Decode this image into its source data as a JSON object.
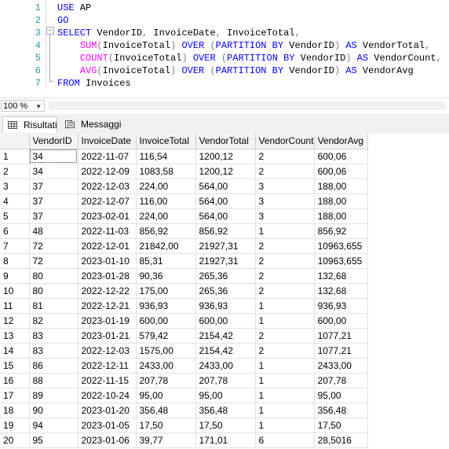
{
  "editor": {
    "lines": [
      {
        "n": "1",
        "tokens": [
          [
            "kw",
            "USE"
          ],
          [
            "tx",
            " AP"
          ]
        ]
      },
      {
        "n": "2",
        "tokens": [
          [
            "kw",
            "GO"
          ]
        ]
      },
      {
        "n": "3",
        "tokens": [
          [
            "kw",
            "SELECT"
          ],
          [
            "tx",
            " VendorID"
          ],
          [
            "op",
            ","
          ],
          [
            "tx",
            " InvoiceDate"
          ],
          [
            "op",
            ","
          ],
          [
            "tx",
            " InvoiceTotal"
          ],
          [
            "op",
            ","
          ]
        ]
      },
      {
        "n": "4",
        "tokens": [
          [
            "tx",
            "    "
          ],
          [
            "fn",
            "SUM"
          ],
          [
            "op",
            "("
          ],
          [
            "tx",
            "InvoiceTotal"
          ],
          [
            "op",
            ")"
          ],
          [
            "tx",
            " "
          ],
          [
            "kw",
            "OVER"
          ],
          [
            "tx",
            " "
          ],
          [
            "op",
            "("
          ],
          [
            "kw",
            "PARTITION BY"
          ],
          [
            "tx",
            " VendorID"
          ],
          [
            "op",
            ")"
          ],
          [
            "tx",
            " "
          ],
          [
            "kw",
            "AS"
          ],
          [
            "tx",
            " VendorTotal"
          ],
          [
            "op",
            ","
          ]
        ]
      },
      {
        "n": "5",
        "tokens": [
          [
            "tx",
            "    "
          ],
          [
            "fn",
            "COUNT"
          ],
          [
            "op",
            "("
          ],
          [
            "tx",
            "InvoiceTotal"
          ],
          [
            "op",
            ")"
          ],
          [
            "tx",
            " "
          ],
          [
            "kw",
            "OVER"
          ],
          [
            "tx",
            " "
          ],
          [
            "op",
            "("
          ],
          [
            "kw",
            "PARTITION BY"
          ],
          [
            "tx",
            " VendorID"
          ],
          [
            "op",
            ")"
          ],
          [
            "tx",
            " "
          ],
          [
            "kw",
            "AS"
          ],
          [
            "tx",
            " VendorCount"
          ],
          [
            "op",
            ","
          ]
        ]
      },
      {
        "n": "6",
        "tokens": [
          [
            "tx",
            "    "
          ],
          [
            "fn",
            "AVG"
          ],
          [
            "op",
            "("
          ],
          [
            "tx",
            "InvoiceTotal"
          ],
          [
            "op",
            ")"
          ],
          [
            "tx",
            " "
          ],
          [
            "kw",
            "OVER"
          ],
          [
            "tx",
            " "
          ],
          [
            "op",
            "("
          ],
          [
            "kw",
            "PARTITION BY"
          ],
          [
            "tx",
            " VendorID"
          ],
          [
            "op",
            ")"
          ],
          [
            "tx",
            " "
          ],
          [
            "kw",
            "AS"
          ],
          [
            "tx",
            " VendorAvg"
          ]
        ]
      },
      {
        "n": "7",
        "tokens": [
          [
            "kw",
            "FROM"
          ],
          [
            "tx",
            " Invoices"
          ]
        ]
      }
    ]
  },
  "zoom": {
    "value": "100 %"
  },
  "tabs": {
    "results": "Risultati",
    "messages": "Messaggi"
  },
  "grid": {
    "columns": [
      "VendorID",
      "InvoiceDate",
      "InvoiceTotal",
      "VendorTotal",
      "VendorCount",
      "VendorAvg"
    ],
    "rows": [
      [
        "1",
        "34",
        "2022-11-07",
        "116,54",
        "1200,12",
        "2",
        "600,06"
      ],
      [
        "2",
        "34",
        "2022-12-09",
        "1083,58",
        "1200,12",
        "2",
        "600,06"
      ],
      [
        "3",
        "37",
        "2022-12-03",
        "224,00",
        "564,00",
        "3",
        "188,00"
      ],
      [
        "4",
        "37",
        "2022-12-07",
        "116,00",
        "564,00",
        "3",
        "188,00"
      ],
      [
        "5",
        "37",
        "2023-02-01",
        "224,00",
        "564,00",
        "3",
        "188,00"
      ],
      [
        "6",
        "48",
        "2022-11-03",
        "856,92",
        "856,92",
        "1",
        "856,92"
      ],
      [
        "7",
        "72",
        "2022-12-01",
        "21842,00",
        "21927,31",
        "2",
        "10963,655"
      ],
      [
        "8",
        "72",
        "2023-01-10",
        "85,31",
        "21927,31",
        "2",
        "10963,655"
      ],
      [
        "9",
        "80",
        "2023-01-28",
        "90,36",
        "265,36",
        "2",
        "132,68"
      ],
      [
        "10",
        "80",
        "2022-12-22",
        "175,00",
        "265,36",
        "2",
        "132,68"
      ],
      [
        "11",
        "81",
        "2022-12-21",
        "936,93",
        "936,93",
        "1",
        "936,93"
      ],
      [
        "12",
        "82",
        "2023-01-19",
        "600,00",
        "600,00",
        "1",
        "600,00"
      ],
      [
        "13",
        "83",
        "2023-01-21",
        "579,42",
        "2154,42",
        "2",
        "1077,21"
      ],
      [
        "14",
        "83",
        "2022-12-03",
        "1575,00",
        "2154,42",
        "2",
        "1077,21"
      ],
      [
        "15",
        "86",
        "2022-12-11",
        "2433,00",
        "2433,00",
        "1",
        "2433,00"
      ],
      [
        "16",
        "88",
        "2022-11-15",
        "207,78",
        "207,78",
        "1",
        "207,78"
      ],
      [
        "17",
        "89",
        "2022-10-24",
        "95,00",
        "95,00",
        "1",
        "95,00"
      ],
      [
        "18",
        "90",
        "2023-01-20",
        "356,48",
        "356,48",
        "1",
        "356,48"
      ],
      [
        "19",
        "94",
        "2023-01-05",
        "17,50",
        "17,50",
        "1",
        "17,50"
      ],
      [
        "20",
        "95",
        "2023-01-06",
        "39,77",
        "171,01",
        "6",
        "28,5016"
      ]
    ]
  }
}
